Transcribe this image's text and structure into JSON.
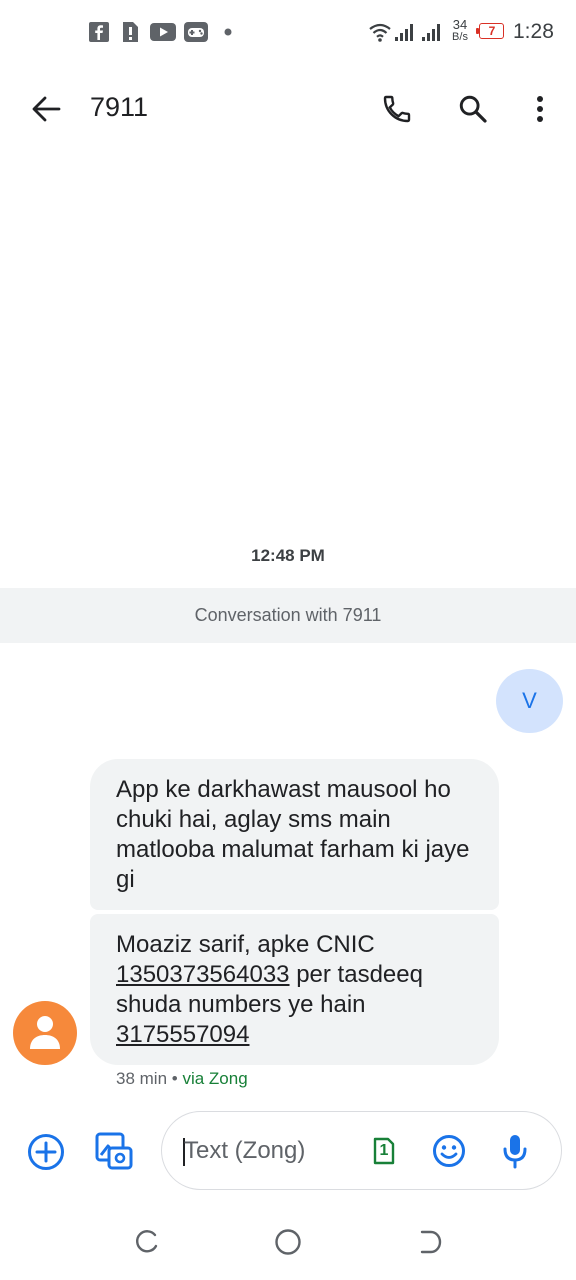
{
  "status_bar": {
    "network_speed_value": "34",
    "network_speed_unit": "B/s",
    "battery_level": "7",
    "time": "1:28",
    "left_icons": [
      "facebook-icon",
      "sim-alert-icon",
      "youtube-icon",
      "game-icon"
    ],
    "right_icons": [
      "wifi-icon",
      "signal-icon",
      "signal-icon",
      "battery-icon"
    ]
  },
  "app_bar": {
    "title": "7911",
    "icons": [
      "back-arrow-icon",
      "phone-icon",
      "search-icon",
      "more-vert-icon"
    ]
  },
  "conversation": {
    "timestamp": "12:48 PM",
    "banner": "Conversation with 7911",
    "self_avatar_letter": "V",
    "messages": [
      {
        "text": "App ke darkhawast mausool ho chuki hai, aglay sms main matlooba malumat farham ki jaye gi"
      },
      {
        "text_before_cnic": "Moaziz sarif, apke CNIC",
        "cnic": "1350373564033",
        "text_after_cnic": "per tasdeeq shuda numbers ye hain",
        "number": "3175557094"
      }
    ],
    "meta": {
      "time_ago": "38 min",
      "separator": "•",
      "via": "via Zong"
    }
  },
  "compose": {
    "placeholder": "Text (Zong)",
    "sim_label": "1",
    "icons": [
      "add-circle-icon",
      "gallery-icon",
      "sim-icon",
      "emoji-icon",
      "mic-icon"
    ]
  },
  "colors": {
    "accent": "#1a73e8",
    "sim_green": "#188038",
    "contact_avatar": "#f6893b",
    "bubble": "#f1f3f4",
    "battery_red": "#d93025"
  }
}
